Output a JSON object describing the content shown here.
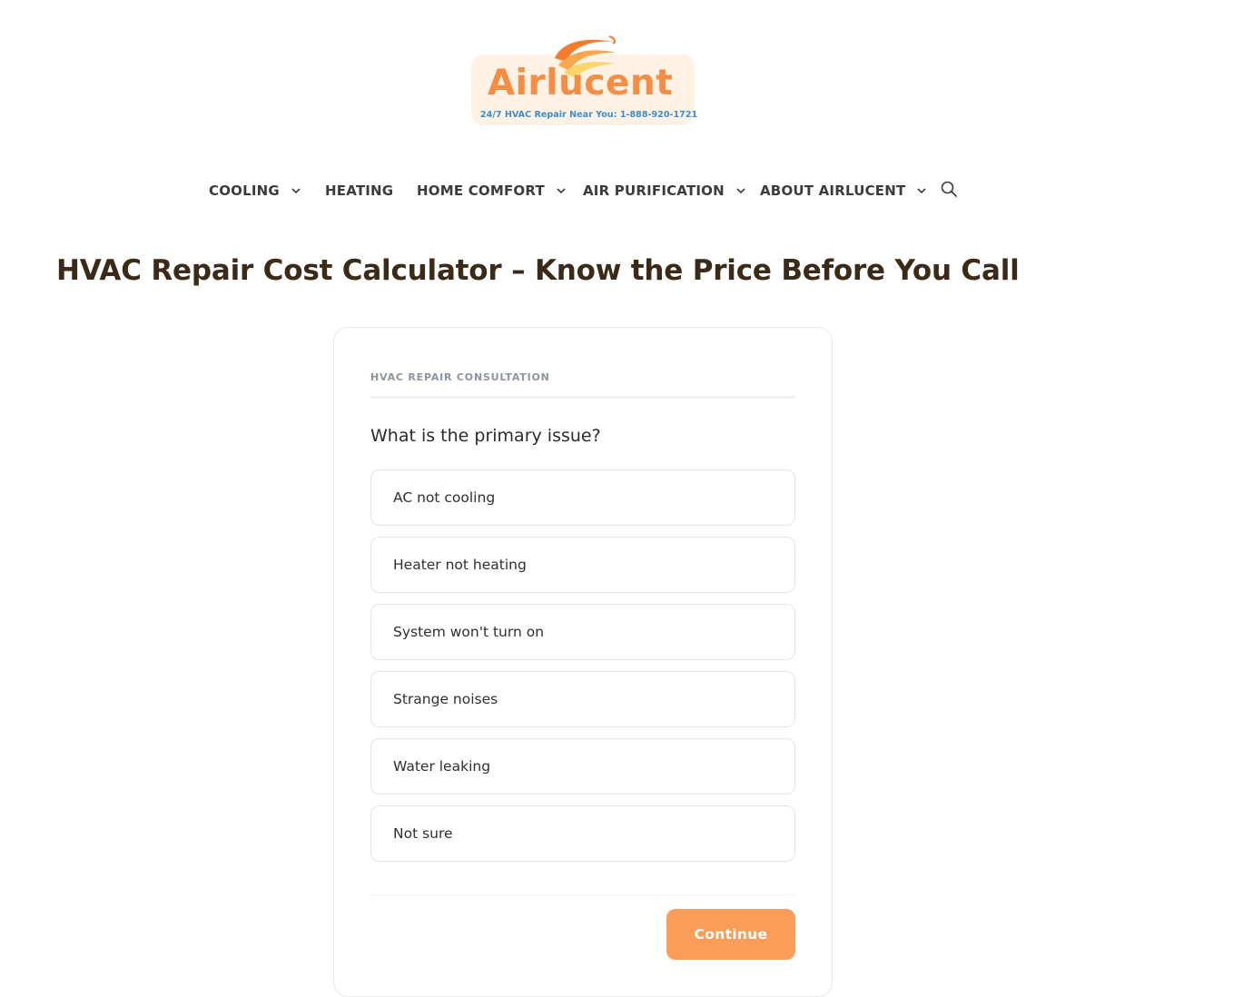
{
  "brand": {
    "name": "Airlucent",
    "tagline": "24/7 HVAC Repair Near You: 1-888-920-1721"
  },
  "nav": {
    "items": [
      {
        "label": "COOLING",
        "has_dropdown": true
      },
      {
        "label": "HEATING",
        "has_dropdown": false
      },
      {
        "label": "HOME COMFORT",
        "has_dropdown": true
      },
      {
        "label": "AIR PURIFICATION",
        "has_dropdown": true
      },
      {
        "label": "ABOUT AIRLUCENT",
        "has_dropdown": true
      }
    ],
    "search_icon": "search-icon",
    "dropdown_icon": "chevron-down-icon"
  },
  "page": {
    "title": "HVAC Repair Cost Calculator – Know the Price Before You Call"
  },
  "quiz": {
    "kicker": "HVAC REPAIR CONSULTATION",
    "question": "What is the primary issue?",
    "options": [
      {
        "label": "AC not cooling"
      },
      {
        "label": "Heater not heating"
      },
      {
        "label": "System won't turn on"
      },
      {
        "label": "Strange noises"
      },
      {
        "label": "Water leaking"
      },
      {
        "label": "Not sure"
      }
    ],
    "continue_label": "Continue"
  },
  "colors": {
    "accent": "#f99d58",
    "brand_orange": "#f58d45",
    "tagline_blue": "#3a8fd1",
    "title": "#3a2a18"
  }
}
